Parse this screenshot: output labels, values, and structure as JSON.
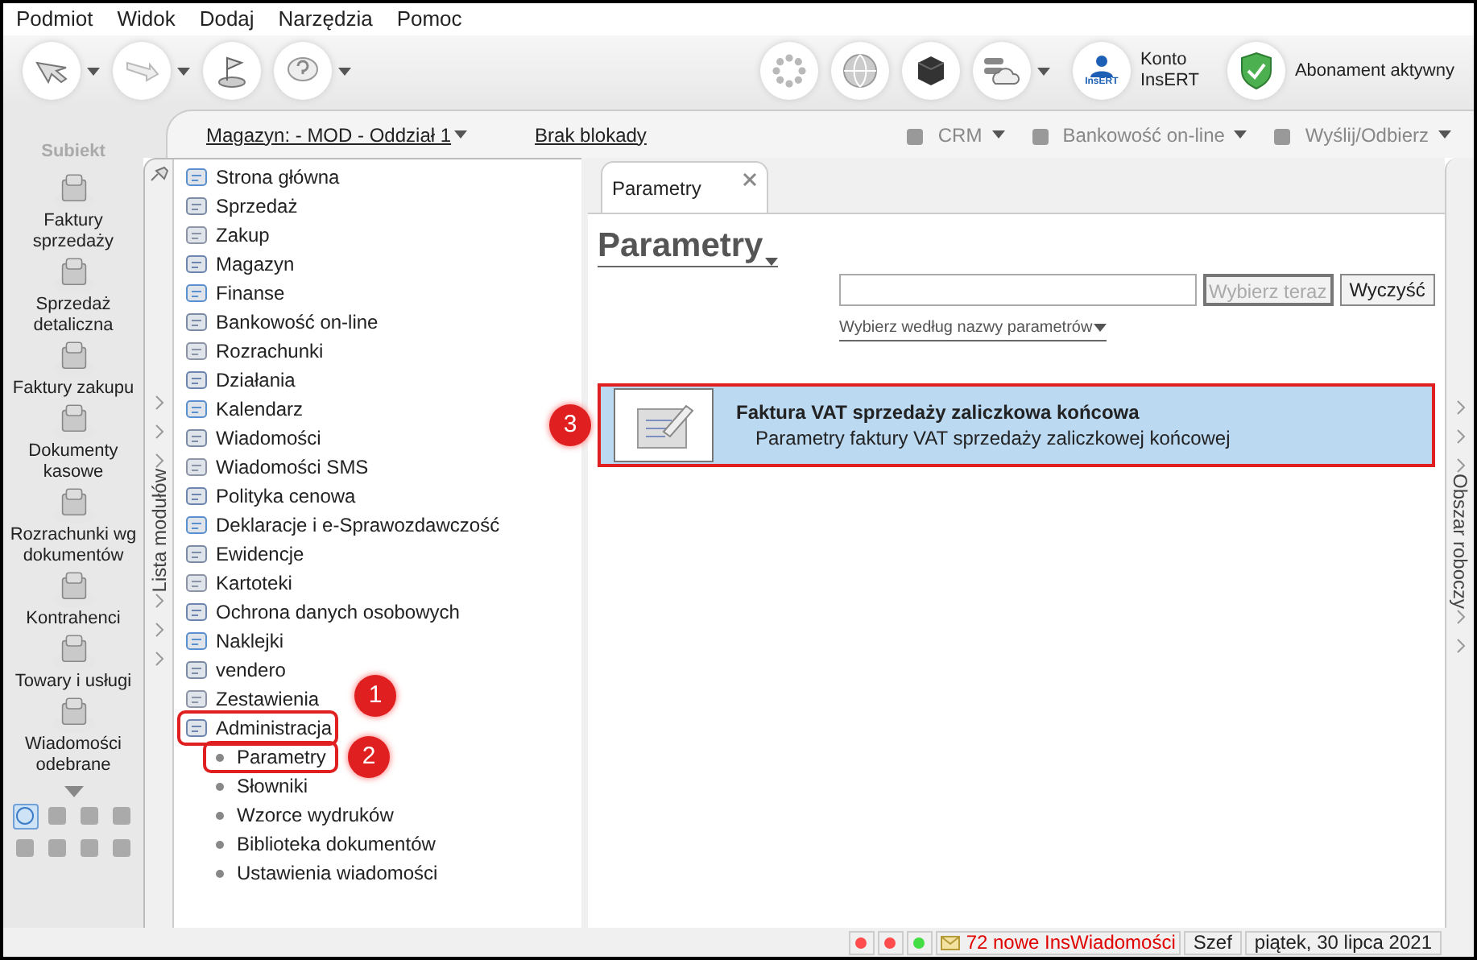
{
  "menu": [
    "Podmiot",
    "Widok",
    "Dodaj",
    "Narzędzia",
    "Pomoc"
  ],
  "toolbar": {
    "account": "Konto InsERT",
    "account_badge": "InsERT",
    "subscription": "Abonament aktywny"
  },
  "nav": {
    "logo": "Subiekt",
    "items": [
      {
        "label": "Faktury sprzedaży"
      },
      {
        "label": "Sprzedaż detaliczna"
      },
      {
        "label": "Faktury zakupu"
      },
      {
        "label": "Dokumenty kasowe"
      },
      {
        "label": "Rozrachunki wg dokumentów"
      },
      {
        "label": "Kontrahenci"
      },
      {
        "label": "Towary i usługi"
      },
      {
        "label": "Wiadomości odebrane"
      }
    ],
    "shortcuts": [
      {
        "selected": true
      },
      {
        "selected": false
      },
      {
        "selected": false
      },
      {
        "selected": false
      },
      {
        "selected": false
      },
      {
        "selected": false
      },
      {
        "selected": false
      },
      {
        "selected": false
      }
    ]
  },
  "header": {
    "warehouse": "Magazyn: - MOD - Oddział 1",
    "lock": "Brak blokady",
    "actions": [
      "CRM",
      "Bankowość on-line",
      "Wyślij/Odbierz"
    ]
  },
  "modules": {
    "label": "Lista modułów",
    "items": [
      {
        "label": "Strona główna"
      },
      {
        "label": "Sprzedaż"
      },
      {
        "label": "Zakup"
      },
      {
        "label": "Magazyn"
      },
      {
        "label": "Finanse"
      },
      {
        "label": "Bankowość on-line"
      },
      {
        "label": "Rozrachunki"
      },
      {
        "label": "Działania"
      },
      {
        "label": "Kalendarz"
      },
      {
        "label": "Wiadomości"
      },
      {
        "label": "Wiadomości SMS"
      },
      {
        "label": "Polityka cenowa"
      },
      {
        "label": "Deklaracje i e-Sprawozdawczość"
      },
      {
        "label": "Ewidencje"
      },
      {
        "label": "Kartoteki"
      },
      {
        "label": "Ochrona danych osobowych"
      },
      {
        "label": "Naklejki"
      },
      {
        "label": "vendero"
      },
      {
        "label": "Zestawienia"
      },
      {
        "label": "Administracja",
        "callout": "1",
        "children": [
          {
            "label": "Parametry",
            "callout": "2"
          },
          {
            "label": "Słowniki"
          },
          {
            "label": "Wzorce wydruków"
          },
          {
            "label": "Biblioteka dokumentów"
          },
          {
            "label": "Ustawienia wiadomości"
          }
        ]
      }
    ]
  },
  "tabs": [
    {
      "label": "Parametry",
      "selected": true
    }
  ],
  "page": {
    "title": "Parametry",
    "search_button": "Wybierz teraz",
    "clear_button": "Wyczyść",
    "filter": "Wybierz według nazwy parametrów",
    "results": [
      {
        "title": "Faktura VAT sprzedaży zaliczkowa końcowa",
        "description": "Parametry faktury VAT sprzedaży zaliczkowej końcowej",
        "selected": true,
        "callout": "3"
      }
    ]
  },
  "workspace": {
    "label": "Obszar roboczy"
  },
  "status_bar": {
    "dots": [
      {
        "color": "#ff4d4d"
      },
      {
        "color": "#ff4d4d"
      },
      {
        "color": "#44dd44"
      }
    ],
    "messages": "72 nowe InsWiadomości",
    "user": "Szef",
    "date": "piątek, 30 lipca 2021"
  }
}
